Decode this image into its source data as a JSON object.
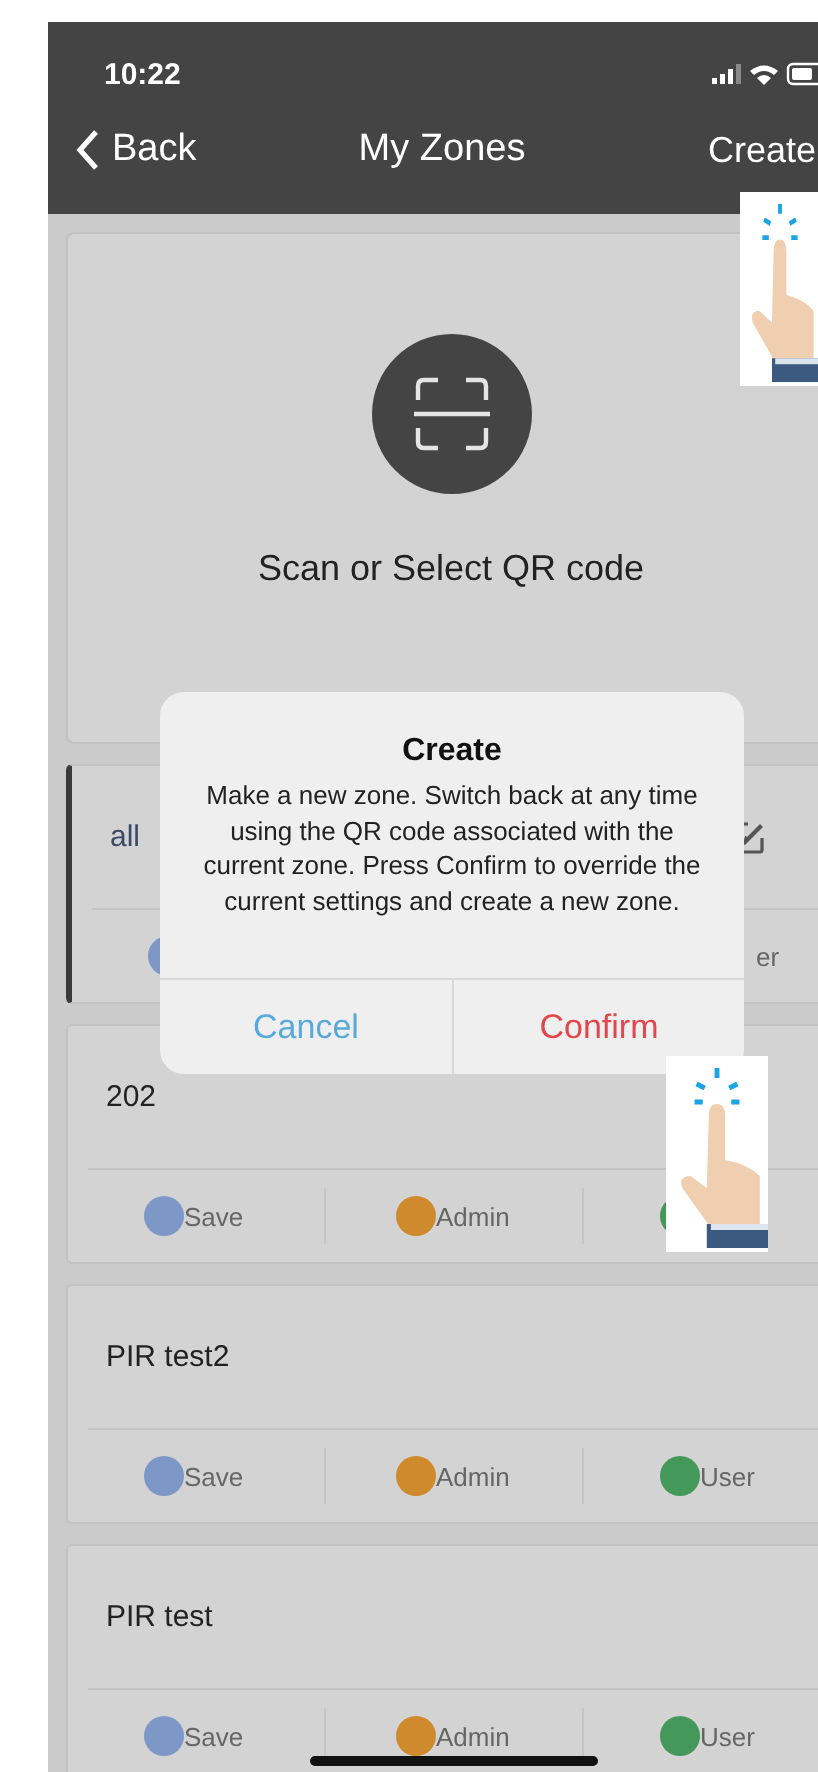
{
  "status_bar": {
    "time": "10:22"
  },
  "nav": {
    "back": "Back",
    "title": "My Zones",
    "action": "Create"
  },
  "scan_card": {
    "label": "Scan or Select QR code"
  },
  "zones": [
    {
      "name": "all",
      "selected": true,
      "editable": true,
      "actions": [
        {
          "kind": "save"
        },
        {
          "kind": "user",
          "label": "er",
          "clipped": true
        }
      ]
    },
    {
      "name": "202",
      "selected": false,
      "editable": false,
      "actions": [
        {
          "kind": "save",
          "label": "Save"
        },
        {
          "kind": "admin",
          "label": "Admin"
        },
        {
          "kind": "user"
        }
      ]
    },
    {
      "name": "PIR test2",
      "selected": false,
      "editable": false,
      "actions": [
        {
          "kind": "save",
          "label": "Save"
        },
        {
          "kind": "admin",
          "label": "Admin"
        },
        {
          "kind": "user",
          "label": "User"
        }
      ]
    },
    {
      "name": "PIR test",
      "selected": false,
      "editable": false,
      "actions": [
        {
          "kind": "save",
          "label": "Save"
        },
        {
          "kind": "admin",
          "label": "Admin"
        },
        {
          "kind": "user",
          "label": "User"
        }
      ]
    }
  ],
  "dialog": {
    "title": "Create",
    "message": "Make a new zone. Switch back at any time using the QR code associated with the current zone. Press Confirm to override the current settings and create a new zone.",
    "buttons": [
      {
        "label": "Cancel",
        "kind": "cancel"
      },
      {
        "label": "Confirm",
        "kind": "confirm"
      }
    ]
  },
  "hints": [
    {
      "kind": "tap"
    },
    {
      "kind": "tap"
    }
  ]
}
